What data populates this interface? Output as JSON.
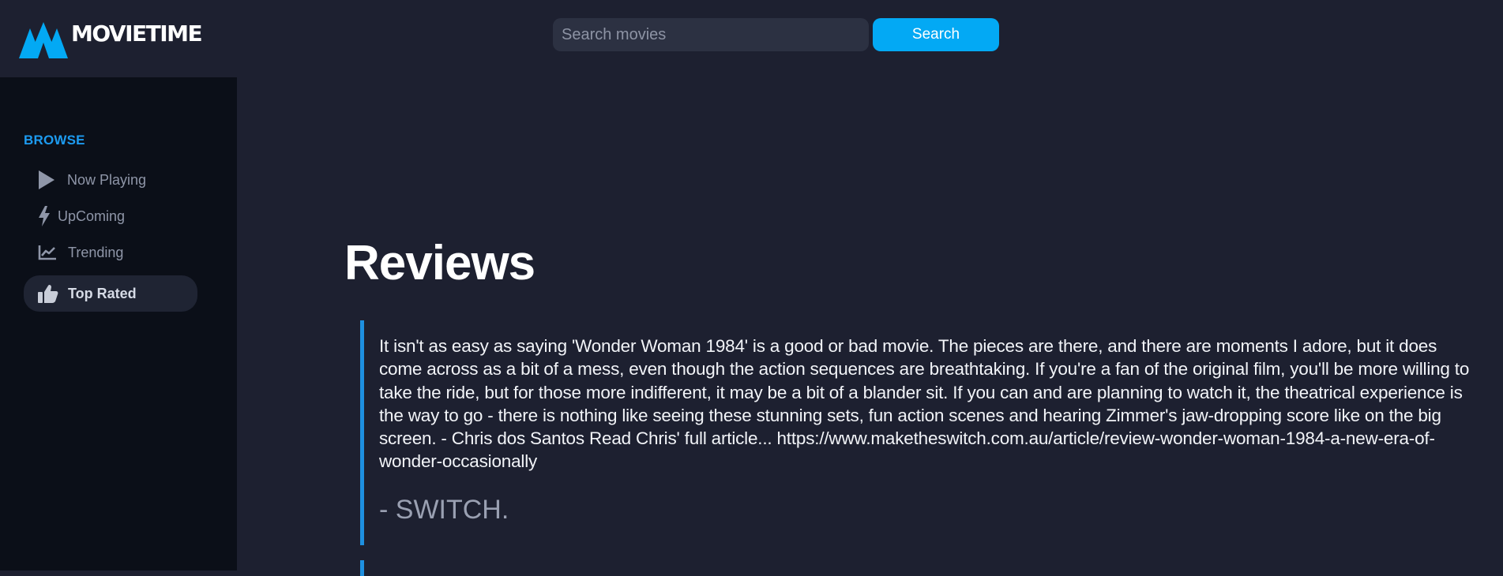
{
  "header": {
    "logo_text": "MOVIETIME",
    "search_placeholder": "Search movies",
    "search_value": "",
    "search_button_label": "Search"
  },
  "sidebar": {
    "heading": "BROWSE",
    "items": [
      {
        "label": "Now Playing",
        "icon": "play-icon",
        "active": false
      },
      {
        "label": "UpComing",
        "icon": "bolt-icon",
        "active": false
      },
      {
        "label": "Trending",
        "icon": "trending-chart-icon",
        "active": false
      },
      {
        "label": "Top Rated",
        "icon": "thumbs-up-icon",
        "active": true
      }
    ]
  },
  "main": {
    "title": "Reviews",
    "reviews": [
      {
        "text": "It isn't as easy as saying 'Wonder Woman 1984' is a good or bad movie. The pieces are there, and there are moments I adore, but it does come across as a bit of a mess, even though the action sequences are breathtaking. If you're a fan of the original film, you'll be more willing to take the ride, but for those more indifferent, it may be a bit of a blander sit. If you can and are planning to watch it, the theatrical experience is the way to go - there is nothing like seeing these stunning sets, fun action scenes and hearing Zimmer's jaw-dropping score like on the big screen. - Chris dos Santos Read Chris' full article... https://www.maketheswitch.com.au/article/review-wonder-woman-1984-a-new-era-of-wonder-occasionally",
        "author": "- SWITCH."
      }
    ]
  },
  "colors": {
    "background": "#1d2030",
    "sidebar": "#0b0f18",
    "accent": "#03a9f4",
    "heading_accent": "#1d9bf0"
  }
}
